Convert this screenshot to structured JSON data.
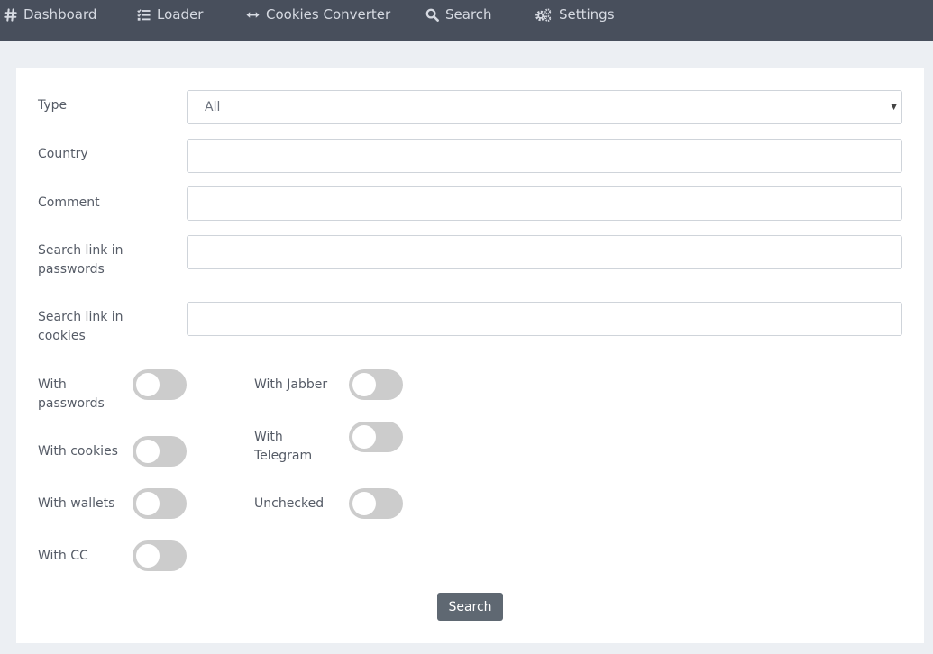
{
  "nav": {
    "items": [
      {
        "label": "Dashboard",
        "icon": "hash-icon"
      },
      {
        "label": "Loader",
        "icon": "list-check-icon"
      },
      {
        "label": "Cookies Converter",
        "icon": "arrows-horizontal-icon"
      },
      {
        "label": "Search",
        "icon": "search-icon"
      },
      {
        "label": "Settings",
        "icon": "gears-icon"
      }
    ]
  },
  "form": {
    "type": {
      "label": "Type",
      "value": "All"
    },
    "country": {
      "label": "Country",
      "value": ""
    },
    "comment": {
      "label": "Comment",
      "value": ""
    },
    "link_passwords": {
      "label": "Search link in passwords",
      "value": ""
    },
    "link_cookies": {
      "label": "Search link in cookies",
      "value": ""
    },
    "toggles_left": [
      {
        "label": "With passwords",
        "checked": false
      },
      {
        "label": "With cookies",
        "checked": false
      },
      {
        "label": "With wallets",
        "checked": false
      },
      {
        "label": "With CC",
        "checked": false
      }
    ],
    "toggles_right": [
      {
        "label": "With Jabber",
        "checked": false
      },
      {
        "label": "With Telegram",
        "checked": false
      },
      {
        "label": "Unchecked",
        "checked": false
      }
    ],
    "submit_label": "Search"
  },
  "colors": {
    "topbar": "#484f5c",
    "page_bg": "#eceff3",
    "toggle_off": "#cccccc",
    "button": "#5f6872"
  }
}
